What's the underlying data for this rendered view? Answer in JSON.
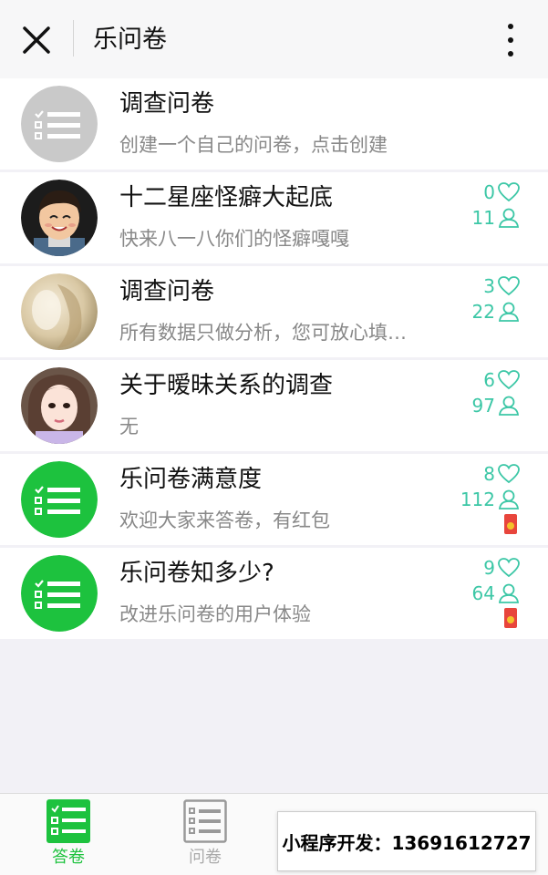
{
  "header": {
    "title": "乐问卷",
    "close_icon": "close-icon",
    "more_icon": "more-vertical-icon"
  },
  "colors": {
    "accent_green": "#1dc23e",
    "stat_teal": "#3cc7a6",
    "redpack_red": "#e8453c"
  },
  "items": [
    {
      "title": "调查问卷",
      "desc": "创建一个自己的问卷，点击创建",
      "avatar": "gray-list-icon",
      "likes": "",
      "participants": "",
      "redpack": false
    },
    {
      "title": "十二星座怪癖大起底",
      "desc": "快来八一八你们的怪癖嘎嘎",
      "avatar": "cartoon-boy-photo",
      "likes": "0",
      "participants": "11",
      "redpack": false
    },
    {
      "title": "调查问卷",
      "desc": "所有数据只做分析，您可放心填…",
      "avatar": "soft-portrait-photo",
      "likes": "3",
      "participants": "22",
      "redpack": false
    },
    {
      "title": "关于暧昧关系的调查",
      "desc": "无",
      "avatar": "girl-selfie-photo",
      "likes": "6",
      "participants": "97",
      "redpack": false
    },
    {
      "title": "乐问卷满意度",
      "desc": "欢迎大家来答卷，有红包",
      "avatar": "green-list-icon",
      "likes": "8",
      "participants": "112",
      "redpack": true
    },
    {
      "title": "乐问卷知多少?",
      "desc": "改进乐问卷的用户体验",
      "avatar": "green-list-icon",
      "likes": "9",
      "participants": "64",
      "redpack": true
    }
  ],
  "tabs": [
    {
      "label": "答卷",
      "icon": "answer-list-icon",
      "active": true
    },
    {
      "label": "问卷",
      "icon": "questionnaire-list-icon",
      "active": false
    }
  ],
  "watermark": "小程序开发：13691612727"
}
